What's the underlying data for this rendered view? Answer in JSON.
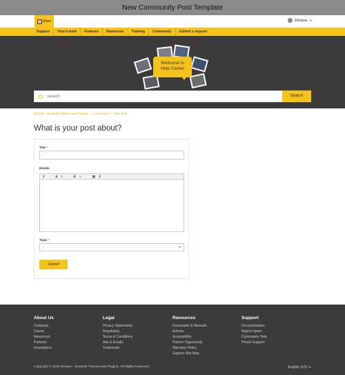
{
  "window": {
    "title": "New Community Post Template"
  },
  "header": {
    "logo_text": "Jovis",
    "user_name": "Diziana"
  },
  "nav": {
    "items": [
      "Support",
      "How it work",
      "Features",
      "Resources",
      "Training",
      "Community",
      "Submit a request"
    ]
  },
  "hero": {
    "welcome_line1": "Welcome to",
    "welcome_line2": "Help Center"
  },
  "search": {
    "placeholder": "Search",
    "button_label": "Search"
  },
  "breadcrumb": {
    "items": [
      "Diziana - Zendesk Themes and Plugins",
      "Community",
      "New post"
    ]
  },
  "page": {
    "title": "What is your post about?"
  },
  "form": {
    "title_label": "Title",
    "required_mark": "*",
    "details_label": "Details",
    "toolbar": {
      "paragraph": "¶",
      "bold": "B",
      "italic": "I",
      "bullets": "☰",
      "numbered": "≡",
      "image": "▨",
      "link": "⚲"
    },
    "topic_label": "Topic",
    "topic_value": "-",
    "submit_label": "Submit"
  },
  "footer": {
    "columns": [
      {
        "heading": "About Us",
        "links": [
          "Company",
          "Career",
          "Newsroom",
          "Partners",
          "Innovations"
        ]
      },
      {
        "heading": "Legal",
        "links": [
          "Privacy Statements",
          "Regulatory",
          "Terms & Conditions",
          "Ads & Emails",
          "Trademark"
        ]
      },
      {
        "heading": "Resources",
        "links": [
          "Downloads & Manuals",
          "Articles",
          "Accessibility",
          "Partner Opportunity",
          "Warranty Policy",
          "Support Site Map"
        ]
      },
      {
        "heading": "Support",
        "links": [
          "Documentation",
          "Report Spam",
          "Community Help",
          "Phone Support"
        ]
      }
    ],
    "copyright": "Copyright © 2019 Diziana - Zendesk Themes and Plugins. All Rights Reserved.",
    "language": "English (US)"
  },
  "colors": {
    "accent": "#f5c31b",
    "dark": "#3b3b3b",
    "link": "#f2a900"
  }
}
